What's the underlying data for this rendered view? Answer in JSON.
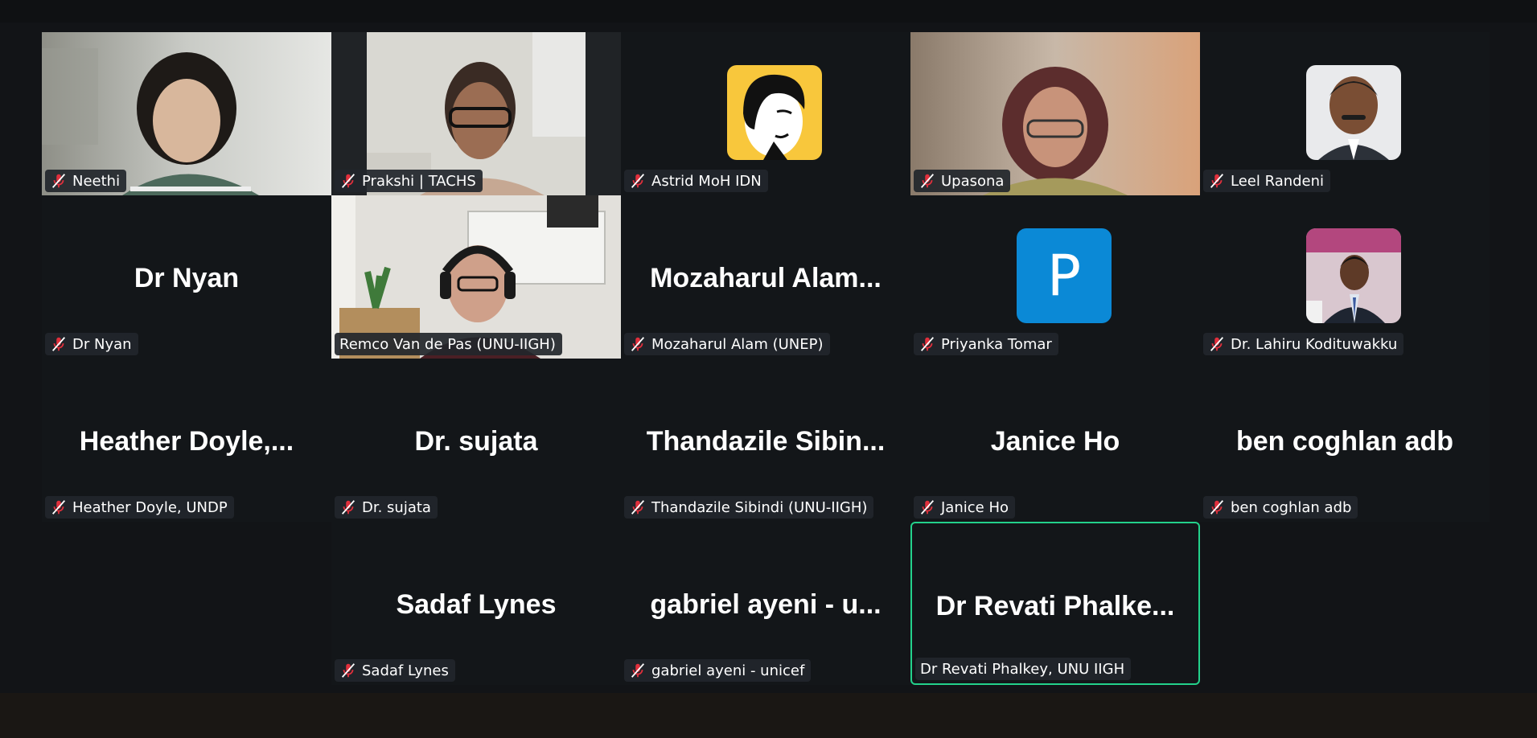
{
  "app": {
    "name": "Zoom meeting - gallery view"
  },
  "colors": {
    "active_speaker_border": "#23d18b",
    "muted_icon": "#e02f3c",
    "avatar_p": "#0b89d6"
  },
  "tiles": [
    {
      "id": "neethi",
      "name_tag": "Neethi",
      "muted": true,
      "display": "video"
    },
    {
      "id": "prakshi",
      "name_tag": "Prakshi | TACHS",
      "muted": true,
      "display": "video"
    },
    {
      "id": "astrid",
      "name_tag": "Astrid MoH IDN",
      "muted": true,
      "display": "avatar"
    },
    {
      "id": "upasona",
      "name_tag": "Upasona",
      "muted": true,
      "display": "video"
    },
    {
      "id": "leel",
      "name_tag": "Leel Randeni",
      "muted": true,
      "display": "avatar"
    },
    {
      "id": "drnyan",
      "big_name": "Dr Nyan",
      "name_tag": "Dr Nyan",
      "muted": true,
      "display": "name"
    },
    {
      "id": "remco",
      "name_tag": "Remco Van de Pas (UNU-IIGH)",
      "muted": false,
      "display": "video"
    },
    {
      "id": "mozaharul",
      "big_name": "Mozaharul  Alam...",
      "name_tag": "Mozaharul Alam (UNEP)",
      "muted": true,
      "display": "name"
    },
    {
      "id": "priyanka",
      "avatar_letter": "P",
      "name_tag": "Priyanka Tomar",
      "muted": true,
      "display": "avatar"
    },
    {
      "id": "lahiru",
      "name_tag": "Dr. Lahiru Kodituwakku",
      "muted": true,
      "display": "avatar"
    },
    {
      "id": "heather",
      "big_name": "Heather  Doyle,...",
      "name_tag": "Heather Doyle, UNDP",
      "muted": true,
      "display": "name"
    },
    {
      "id": "sujata",
      "big_name": "Dr. sujata",
      "name_tag": "Dr. sujata",
      "muted": true,
      "display": "name"
    },
    {
      "id": "thandazile",
      "big_name": "Thandazile  Sibin...",
      "name_tag": "Thandazile Sibindi (UNU-IIGH)",
      "muted": true,
      "display": "name"
    },
    {
      "id": "janice",
      "big_name": "Janice Ho",
      "name_tag": "Janice Ho",
      "muted": true,
      "display": "name"
    },
    {
      "id": "ben",
      "big_name": "ben coghlan adb",
      "name_tag": "ben coghlan adb",
      "muted": true,
      "display": "name"
    },
    {
      "id": "sadaf",
      "big_name": "Sadaf Lynes",
      "name_tag": "Sadaf Lynes",
      "muted": true,
      "display": "name"
    },
    {
      "id": "gabriel",
      "big_name": "gabriel ayeni - u...",
      "name_tag": "gabriel ayeni - unicef",
      "muted": true,
      "display": "name"
    },
    {
      "id": "revati",
      "big_name": "Dr Revati Phalke...",
      "name_tag": "Dr Revati Phalkey, UNU IIGH",
      "muted": false,
      "display": "name",
      "active_speaker": true
    }
  ]
}
